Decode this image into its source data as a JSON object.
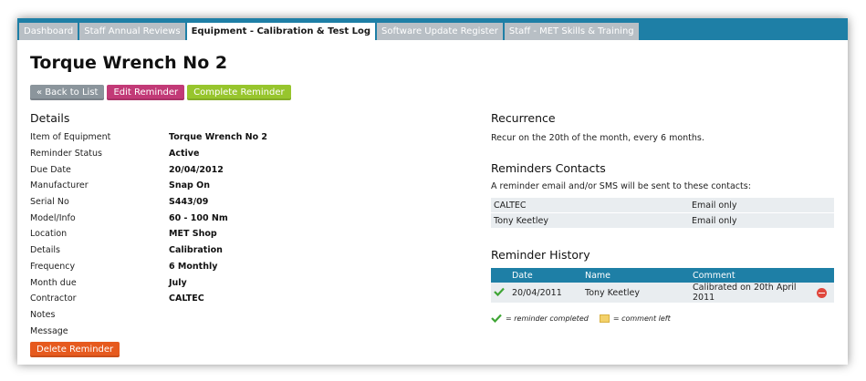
{
  "tabs": [
    {
      "label": "Dashboard",
      "active": false
    },
    {
      "label": "Staff Annual Reviews",
      "active": false
    },
    {
      "label": "Equipment - Calibration & Test Log",
      "active": true
    },
    {
      "label": "Software Update Register",
      "active": false
    },
    {
      "label": "Staff - MET Skills & Training",
      "active": false
    }
  ],
  "page_title": "Torque Wrench No 2",
  "buttons": {
    "back": "« Back to List",
    "edit": "Edit Reminder",
    "complete": "Complete Reminder",
    "delete": "Delete Reminder"
  },
  "details": {
    "heading": "Details",
    "rows": [
      {
        "label": "Item of Equipment",
        "value": "Torque Wrench No 2"
      },
      {
        "label": "Reminder Status",
        "value": "Active"
      },
      {
        "label": "Due Date",
        "value": "20/04/2012"
      },
      {
        "label": "Manufacturer",
        "value": "Snap On"
      },
      {
        "label": "Serial No",
        "value": "S443/09"
      },
      {
        "label": "Model/Info",
        "value": "60 - 100 Nm"
      },
      {
        "label": "Location",
        "value": "MET Shop"
      },
      {
        "label": "Details",
        "value": "Calibration"
      },
      {
        "label": "Frequency",
        "value": "6 Monthly"
      },
      {
        "label": "Month due",
        "value": "July"
      },
      {
        "label": "Contractor",
        "value": "CALTEC"
      },
      {
        "label": "Notes",
        "value": ""
      },
      {
        "label": "Message",
        "value": ""
      }
    ]
  },
  "recurrence": {
    "heading": "Recurrence",
    "text": "Recur on the 20th of the month, every 6 months."
  },
  "contacts": {
    "heading": "Reminders Contacts",
    "intro": "A reminder email and/or SMS will be sent to these contacts:",
    "rows": [
      {
        "name": "CALTEC",
        "method": "Email only"
      },
      {
        "name": "Tony Keetley",
        "method": "Email only"
      }
    ]
  },
  "history": {
    "heading": "Reminder History",
    "columns": [
      "Date",
      "Name",
      "Comment"
    ],
    "rows": [
      {
        "date": "20/04/2011",
        "name": "Tony Keetley",
        "comment": "Calibrated on 20th April 2011"
      }
    ],
    "legend_completed": "= reminder completed",
    "legend_comment": "= comment left"
  },
  "colors": {
    "tabbar": "#1e7fa6",
    "btn_back": "#8b959c",
    "btn_edit": "#c23a77",
    "btn_complete": "#97c52d",
    "btn_delete": "#e65a1e"
  }
}
